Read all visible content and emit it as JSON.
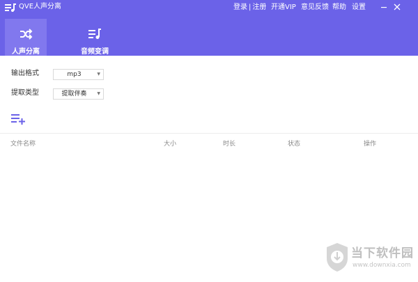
{
  "app": {
    "title": "QVE人声分离",
    "logo_icon": "music-list-logo-icon"
  },
  "menu": {
    "login": "登录",
    "separator": "|",
    "register": "注册",
    "vip": "开通VIP",
    "feedback": "意见反馈",
    "help": "帮助",
    "settings": "设置"
  },
  "window_controls": {
    "minimize": "minimize-icon",
    "close": "close-icon"
  },
  "tabs": [
    {
      "label": "人声分离",
      "icon": "shuffle-icon",
      "active": true
    },
    {
      "label": "音频变调",
      "icon": "music-note-list-icon",
      "active": false
    }
  ],
  "form": {
    "output_format": {
      "label": "输出格式",
      "value": "mp3"
    },
    "extract_type": {
      "label": "提取类型",
      "value": "提取伴奏"
    }
  },
  "add_button_icon": "add-to-list-icon",
  "table": {
    "columns": [
      "文件名称",
      "大小",
      "时长",
      "状态",
      "操作"
    ]
  },
  "watermark": {
    "title": "当下软件园",
    "url": "www.downxia.com"
  },
  "colors": {
    "header": "#6b62e8",
    "active_tab": "#8178ee",
    "accent": "#6b62e8"
  }
}
